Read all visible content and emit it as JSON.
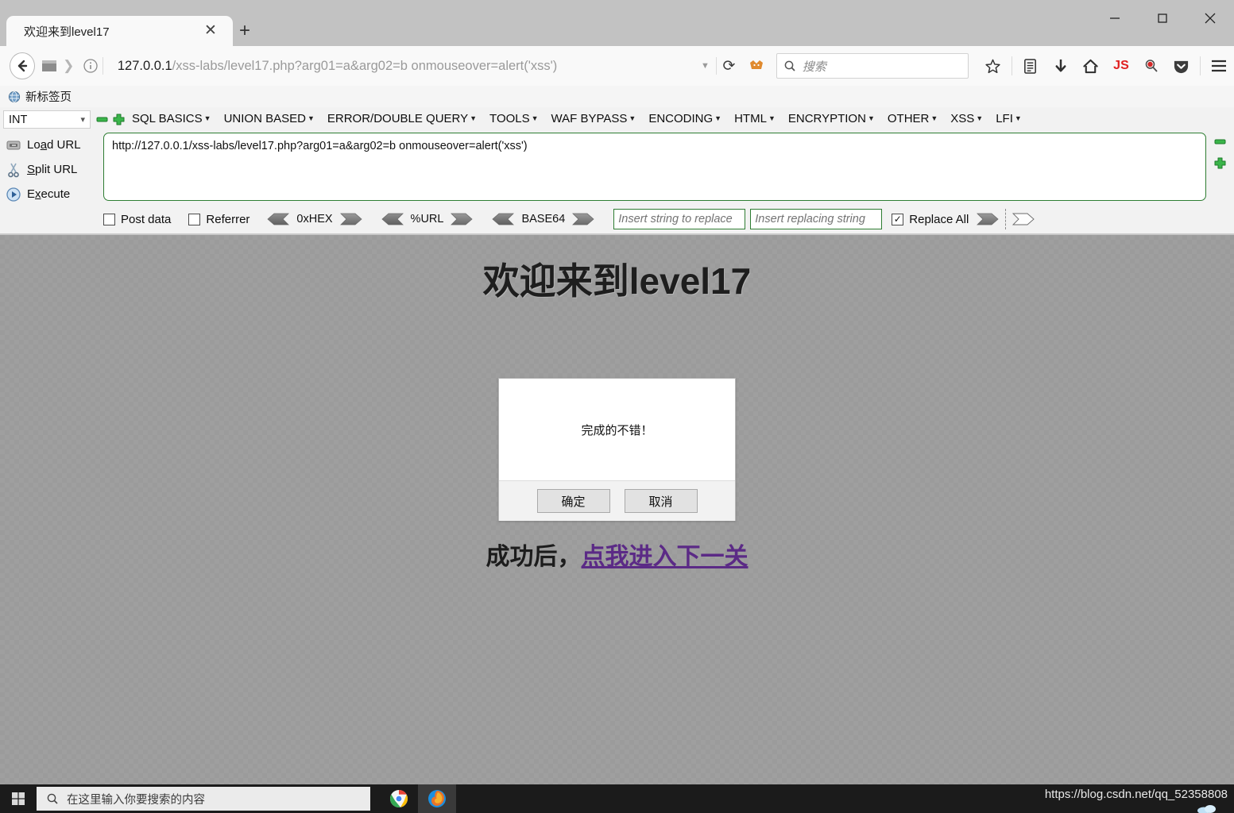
{
  "window": {
    "controls": {
      "minimize": "—",
      "maximize": "☐",
      "close": "✕"
    }
  },
  "tabs": [
    {
      "title": "欢迎来到level17",
      "close": "✕"
    }
  ],
  "new_tab_label": "+",
  "navbar": {
    "url_host": "127.0.0.1",
    "url_path": "/xss-labs/level17.php?arg01=a&arg02=b onmouseover=alert('xss')",
    "dropdown_caret": "▼",
    "reload_glyph": "⟳",
    "search_placeholder": "搜索",
    "icons": [
      "star-icon",
      "reader-icon",
      "downloads-icon",
      "home-icon",
      "js-icon",
      "zoom-search-icon",
      "pocket-icon",
      "hamburger-menu-icon"
    ]
  },
  "bookmarks": [
    {
      "label": "新标签页",
      "icon": "globe-icon"
    }
  ],
  "hackbar": {
    "type_select": {
      "value": "INT",
      "caret": "⌄"
    },
    "menu": [
      "SQL BASICS",
      "UNION BASED",
      "ERROR/DOUBLE QUERY",
      "TOOLS",
      "WAF BYPASS",
      "ENCODING",
      "HTML",
      "ENCRYPTION",
      "OTHER",
      "XSS",
      "LFI"
    ],
    "menu_caret": "▾",
    "actions": [
      {
        "label_pre": "Lo",
        "label_key": "a",
        "label_post": "d URL",
        "icon": "load-url-icon"
      },
      {
        "label_pre": "",
        "label_key": "S",
        "label_post": "plit URL",
        "icon": "scissors-icon"
      },
      {
        "label_pre": "E",
        "label_key": "x",
        "label_post": "ecute",
        "icon": "execute-play-icon"
      }
    ],
    "url_value": "http://127.0.0.1/xss-labs/level17.php?arg01=a&arg02=b onmouseover=alert('xss')",
    "checkboxes": [
      {
        "label": "Post data",
        "checked": false
      },
      {
        "label": "Referrer",
        "checked": false
      }
    ],
    "encoders": [
      "0xHEX",
      "%URL",
      "BASE64"
    ],
    "replace_from_placeholder": "Insert string to replace",
    "replace_to_placeholder": "Insert replacing string",
    "replace_all": {
      "label": "Replace All",
      "checked": true,
      "check_glyph": "✓"
    }
  },
  "page": {
    "heading": "欢迎来到level17",
    "dialog": {
      "message": "完成的不错！",
      "ok_label": "确定",
      "cancel_label": "取消"
    },
    "success_prefix": "成功后，",
    "success_link": "点我进入下一关"
  },
  "taskbar": {
    "search_placeholder": "在这里输入你要搜索的内容",
    "apps": [
      "chrome-icon",
      "firefox-icon"
    ]
  },
  "watermark": "https://blog.csdn.net/qq_52358808",
  "colors": {
    "hackbar_green": "#2e7d32",
    "page_bg": "#9b9b9b",
    "link_purple": "#5b2a86",
    "accent_green_plus": "#3ab54a"
  }
}
